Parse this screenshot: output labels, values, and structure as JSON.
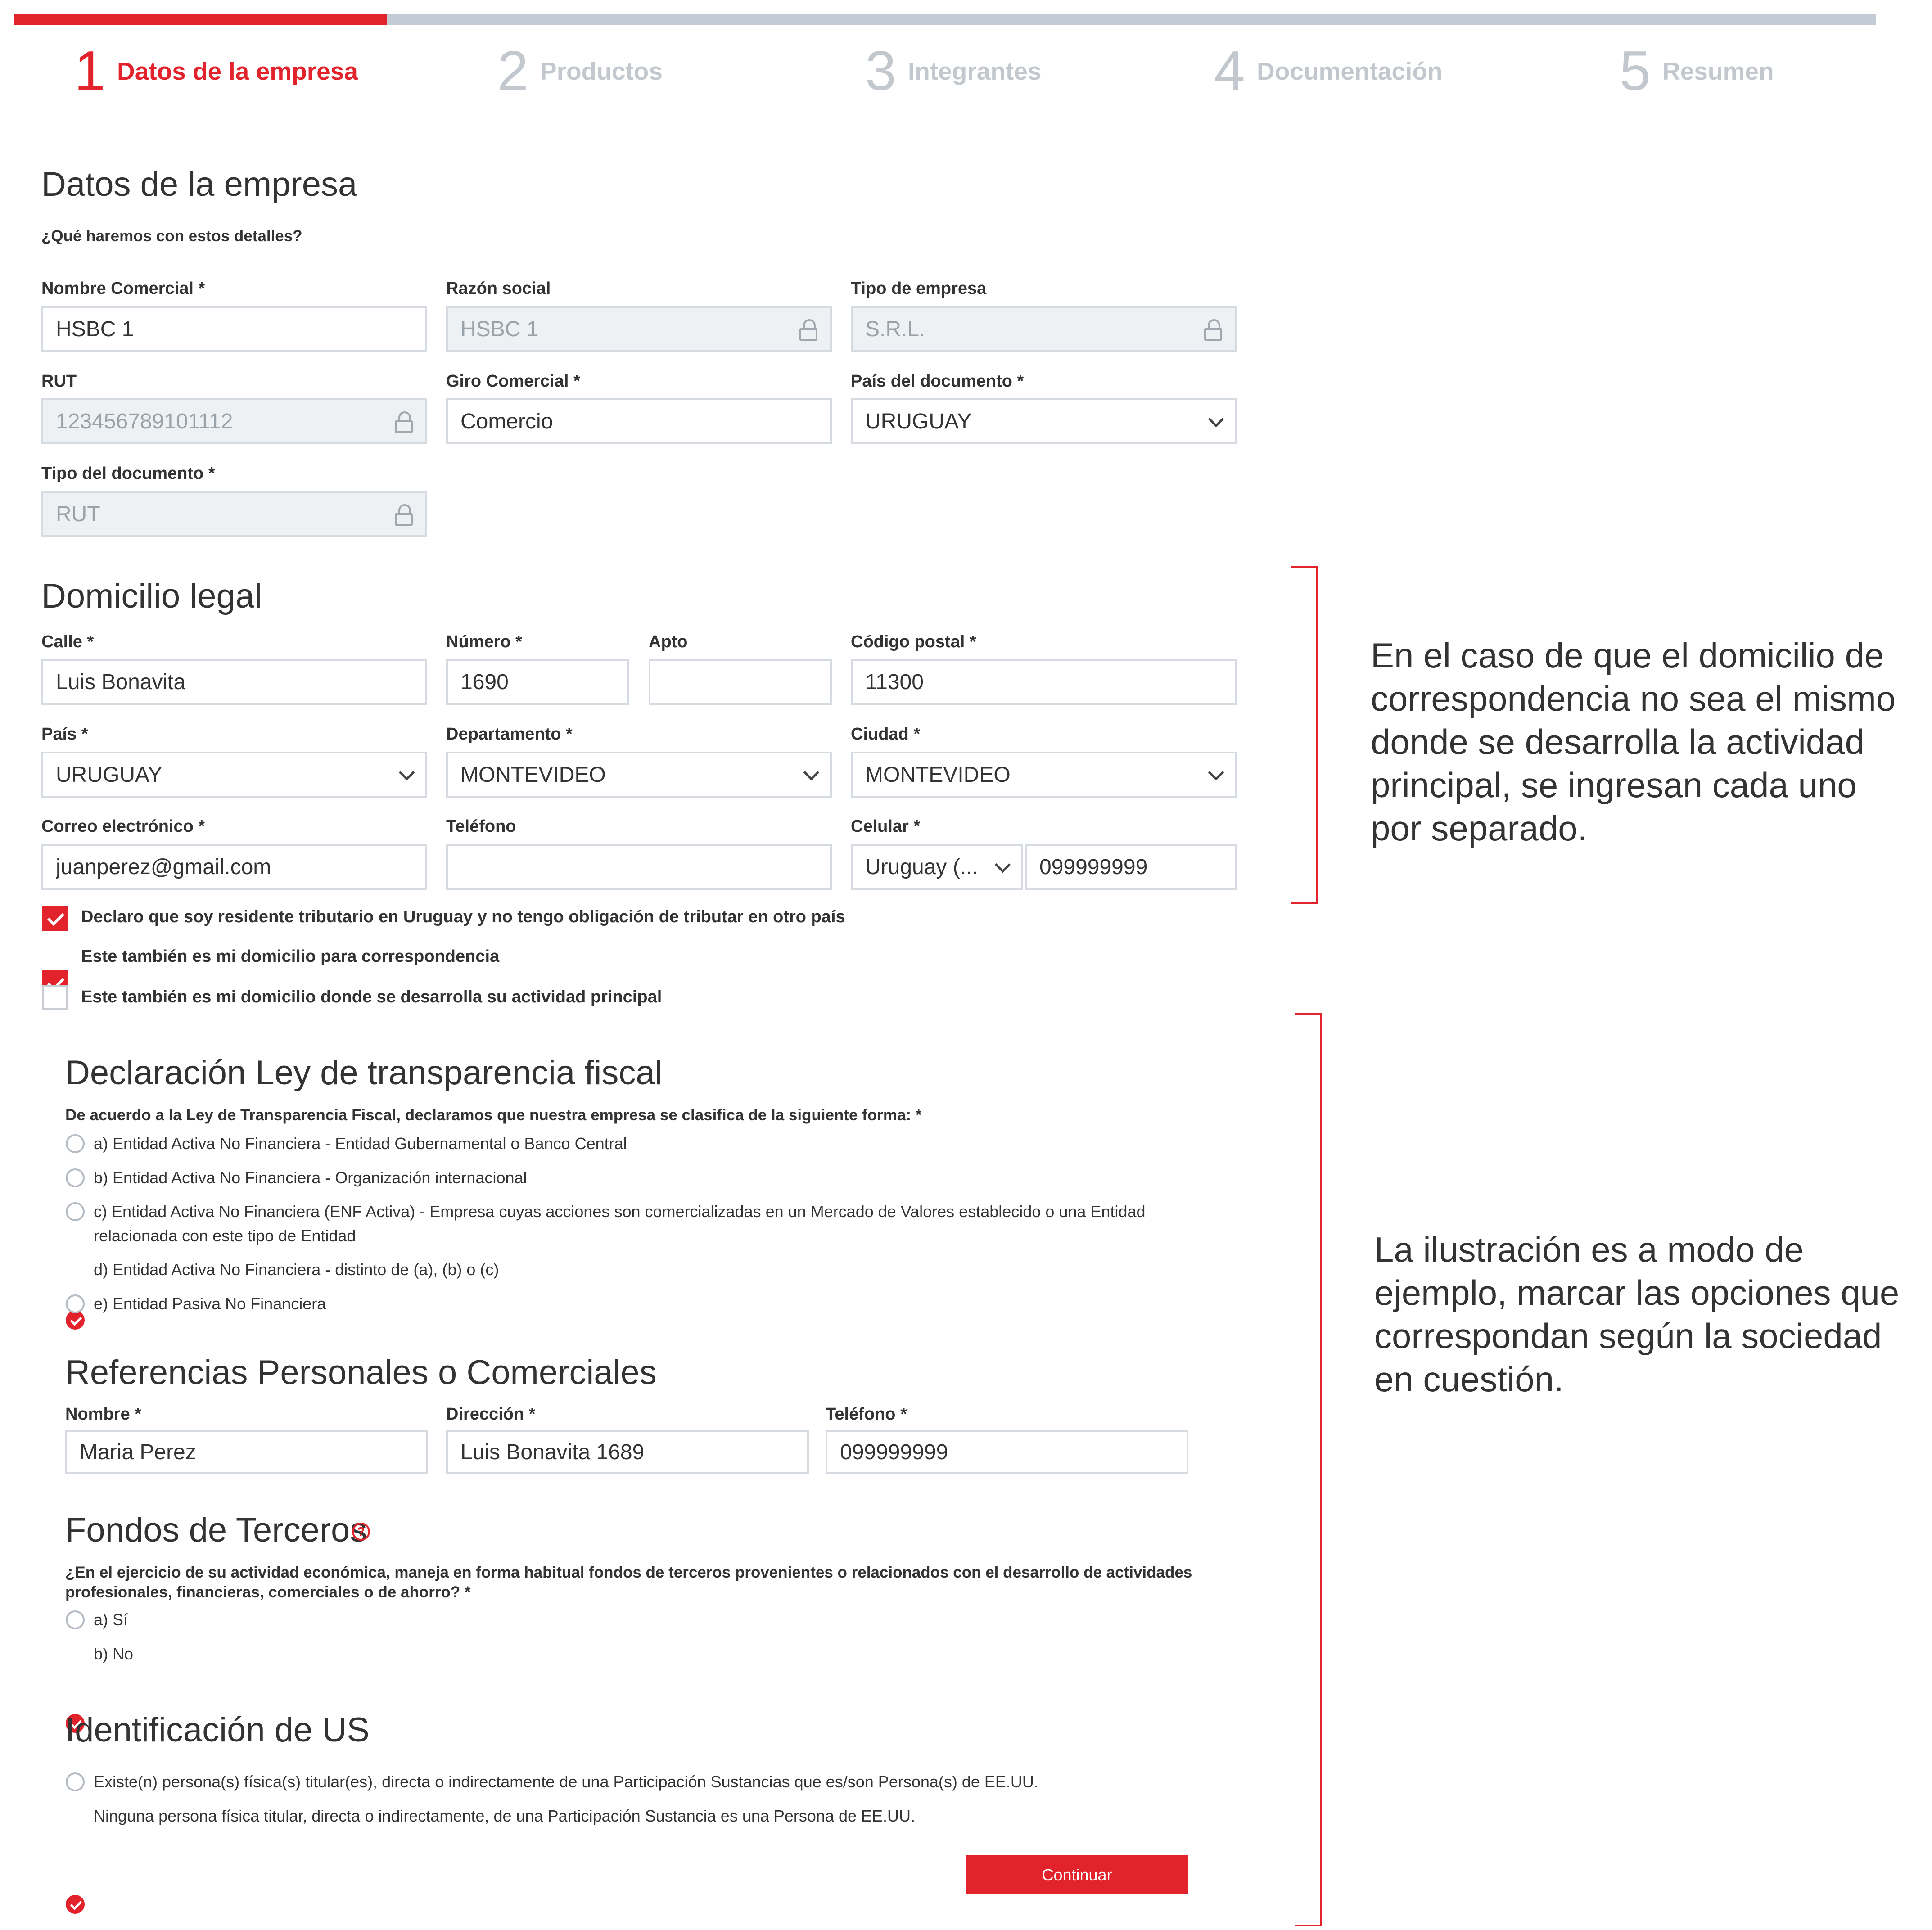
{
  "stepper": {
    "progress_fraction": 0.2,
    "steps": [
      {
        "num": "1",
        "label": "Datos de la empresa"
      },
      {
        "num": "2",
        "label": "Productos"
      },
      {
        "num": "3",
        "label": "Integrantes"
      },
      {
        "num": "4",
        "label": "Documentación"
      },
      {
        "num": "5",
        "label": "Resumen"
      }
    ]
  },
  "company": {
    "title": "Datos de la empresa",
    "hint": "¿Qué haremos con estos detalles?",
    "nombre_comercial": {
      "label": "Nombre Comercial *",
      "value": "HSBC 1"
    },
    "razon_social": {
      "label": "Razón social",
      "value": "HSBC 1"
    },
    "tipo_empresa": {
      "label": "Tipo de empresa",
      "value": "S.R.L."
    },
    "rut": {
      "label": "RUT",
      "value": "123456789101112"
    },
    "giro_comercial": {
      "label": "Giro Comercial *",
      "value": "Comercio"
    },
    "pais_documento": {
      "label": "País del documento *",
      "value": "URUGUAY"
    },
    "tipo_documento": {
      "label": "Tipo del documento *",
      "value": "RUT"
    }
  },
  "address": {
    "title": "Domicilio legal",
    "calle": {
      "label": "Calle *",
      "value": "Luis Bonavita"
    },
    "numero": {
      "label": "Número *",
      "value": "1690"
    },
    "apto": {
      "label": "Apto",
      "value": ""
    },
    "codigo_postal": {
      "label": "Código postal *",
      "value": "11300"
    },
    "pais": {
      "label": "País *",
      "value": "URUGUAY"
    },
    "departamento": {
      "label": "Departamento *",
      "value": "MONTEVIDEO"
    },
    "ciudad": {
      "label": "Ciudad *",
      "value": "MONTEVIDEO"
    },
    "correo": {
      "label": "Correo electrónico *",
      "value": "juanperez@gmail.com"
    },
    "telefono": {
      "label": "Teléfono",
      "value": ""
    },
    "celular": {
      "label": "Celular *",
      "country": "Uruguay (...",
      "value": "099999999"
    },
    "checks": [
      {
        "label": "Declaro que soy residente tributario en Uruguay y no tengo obligación de tributar en otro país",
        "checked": true
      },
      {
        "label": "Este también es mi domicilio para correspondencia",
        "checked": true
      },
      {
        "label": "Este también es mi domicilio donde se desarrolla su actividad principal",
        "checked": false
      }
    ]
  },
  "fiscal": {
    "title": "Declaración Ley de transparencia fiscal",
    "question": "De acuerdo a la Ley de Transparencia Fiscal, declaramos que nuestra empresa se clasifica de la siguiente forma: *",
    "options": [
      {
        "label": "a) Entidad Activa No Financiera - Entidad Gubernamental o Banco Central",
        "checked": false
      },
      {
        "label": "b) Entidad Activa No Financiera - Organización internacional",
        "checked": false
      },
      {
        "label": "c) Entidad Activa No Financiera (ENF Activa) - Empresa cuyas acciones son comercializadas en un Mercado de Valores establecido o una Entidad",
        "label2": "relacionada con este tipo de Entidad",
        "checked": false
      },
      {
        "label": "d) Entidad Activa No Financiera - distinto de (a), (b) o (c)",
        "checked": true
      },
      {
        "label": "e) Entidad Pasiva No Financiera",
        "checked": false
      }
    ]
  },
  "references": {
    "title": "Referencias Personales o Comerciales",
    "nombre": {
      "label": "Nombre *",
      "value": "Maria Perez"
    },
    "direccion": {
      "label": "Dirección *",
      "value": "Luis Bonavita 1689"
    },
    "telefono": {
      "label": "Teléfono *",
      "value": "099999999"
    }
  },
  "funds": {
    "title": "Fondos de Terceros",
    "help": "?",
    "question_line1": "¿En el ejercicio de su actividad económica, maneja en forma habitual fondos de terceros provenientes o relacionados con el desarrollo de actividades",
    "question_line2": "profesionales, financieras, comerciales o de ahorro? *",
    "options": [
      {
        "label": "a) Sí",
        "checked": false
      },
      {
        "label": "b) No",
        "checked": true
      }
    ]
  },
  "us": {
    "title": "Identificación de US",
    "options": [
      {
        "label": "Existe(n) persona(s) física(s) titular(es), directa o indirectamente de una Participación Sustancias que es/son Persona(s) de EE.UU.",
        "checked": false
      },
      {
        "label": "Ninguna persona física titular, directa o indirectamente, de una Participación Sustancia es una Persona de EE.UU.",
        "checked": true
      }
    ]
  },
  "actions": {
    "continue_label": "Continuar"
  },
  "annotations": {
    "note1": [
      "En el caso de que el domicilio de",
      "correspondencia no sea el mismo",
      "donde se desarrolla la actividad",
      "principal, se ingresan cada uno",
      "por separado."
    ],
    "note2": [
      "La ilustración es a modo de",
      "ejemplo, marcar las opciones que",
      "correspondan según la sociedad",
      "en cuestión."
    ]
  },
  "colors": {
    "accent": "#e3232c",
    "inactive_step": "#c2c8ce",
    "track": "#c3ccd5"
  }
}
